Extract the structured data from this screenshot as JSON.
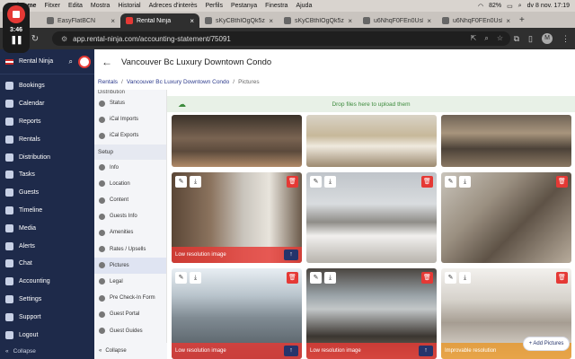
{
  "menubar": {
    "app": "Chrome",
    "items": [
      "Fitxer",
      "Edita",
      "Mostra",
      "Historial",
      "Adreces d'interès",
      "Perfils",
      "Pestanya",
      "Finestra",
      "Ajuda"
    ],
    "battery": "82%",
    "datetime": "dv 8 nov. 17:19"
  },
  "recording": {
    "time": "3:46"
  },
  "tabs": [
    {
      "title": "EasyFlatBCN"
    },
    {
      "title": "Rental Ninja"
    },
    {
      "title": "sKyCBthIOgQk5z..."
    },
    {
      "title": "sKyCBthIOgQk5z..."
    },
    {
      "title": "u6NhqF0FEn0Usl..."
    },
    {
      "title": "u6NhqF0FEn0Usl..."
    }
  ],
  "address": {
    "url": "app.rental-ninja.com/accounting-statement/75091",
    "profile": "M"
  },
  "sidebar": {
    "brand": "Rental Ninja",
    "items": [
      {
        "label": "Bookings"
      },
      {
        "label": "Calendar"
      },
      {
        "label": "Reports"
      },
      {
        "label": "Rentals"
      },
      {
        "label": "Distribution"
      },
      {
        "label": "Tasks"
      },
      {
        "label": "Guests"
      },
      {
        "label": "Timeline"
      },
      {
        "label": "Media"
      },
      {
        "label": "Alerts"
      },
      {
        "label": "Chat"
      },
      {
        "label": "Accounting"
      },
      {
        "label": "Settings"
      },
      {
        "label": "Support"
      },
      {
        "label": "Logout"
      }
    ],
    "collapse": "Collapse"
  },
  "submenu": {
    "cut_label": "Distribution",
    "distribution_items": [
      {
        "label": "Status"
      },
      {
        "label": "iCal Imports"
      },
      {
        "label": "iCal Exports"
      }
    ],
    "setup_label": "Setup",
    "setup_items": [
      {
        "label": "Info"
      },
      {
        "label": "Location"
      },
      {
        "label": "Content"
      },
      {
        "label": "Guests Info"
      },
      {
        "label": "Amenities"
      },
      {
        "label": "Rates / Upsells"
      },
      {
        "label": "Pictures"
      },
      {
        "label": "Legal"
      },
      {
        "label": "Pre Check-In Form"
      },
      {
        "label": "Guest Portal"
      },
      {
        "label": "Guest Guides"
      }
    ],
    "collapse": "Collapse"
  },
  "page": {
    "title": "Vancouver Bc Luxury Downtown Condo",
    "breadcrumbs": [
      "Rentals",
      "Vancouver Bc Luxury Downtown Condo",
      "Pictures"
    ],
    "dropzone": "Drop files here to upload them",
    "add_pictures": "+ Add Pictures"
  },
  "photos": {
    "low_res": "Low resolution image",
    "improvable": "Improvable resolution"
  },
  "colors": {
    "sidebar": "#1e2a4a",
    "danger": "#e53935",
    "primary": "#25346b",
    "success": "#3d8b3d"
  }
}
